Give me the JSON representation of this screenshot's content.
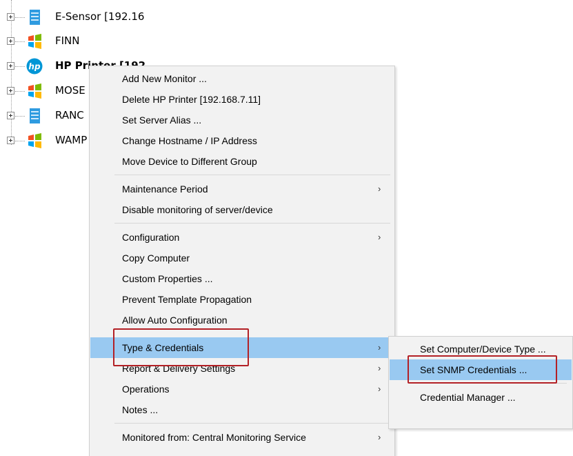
{
  "tree": {
    "items": [
      {
        "label": "E-Sensor [192.16",
        "icon": "server-icon",
        "bold": false
      },
      {
        "label": "FINN",
        "icon": "windows-icon",
        "bold": false
      },
      {
        "label": "HP Printer [192",
        "icon": "hp-logo-icon",
        "bold": true
      },
      {
        "label": "MOSE",
        "icon": "windows-icon",
        "bold": false
      },
      {
        "label": "RANC",
        "icon": "server-icon",
        "bold": false
      },
      {
        "label": "WAMP",
        "icon": "windows-icon",
        "bold": false
      }
    ]
  },
  "context_menu": {
    "items": [
      {
        "label": "Add New Monitor ...",
        "submenu": false
      },
      {
        "label": "Delete HP Printer [192.168.7.11]",
        "submenu": false
      },
      {
        "label": "Set Server Alias ...",
        "submenu": false
      },
      {
        "label": "Change Hostname / IP Address",
        "submenu": false
      },
      {
        "label": "Move Device to Different Group",
        "submenu": false
      },
      {
        "label": "Maintenance Period",
        "submenu": true
      },
      {
        "label": "Disable monitoring of server/device",
        "submenu": false
      },
      {
        "label": "Configuration",
        "submenu": true
      },
      {
        "label": "Copy Computer",
        "submenu": false
      },
      {
        "label": "Custom Properties ...",
        "submenu": false
      },
      {
        "label": "Prevent Template Propagation",
        "submenu": false
      },
      {
        "label": "Allow Auto Configuration",
        "submenu": false
      },
      {
        "label": "Type & Credentials",
        "submenu": true,
        "highlighted": true
      },
      {
        "label": "Report & Delivery Settings",
        "submenu": true
      },
      {
        "label": "Operations",
        "submenu": true
      },
      {
        "label": "Notes ...",
        "submenu": false
      },
      {
        "label": "Monitored from: Central Monitoring Service",
        "submenu": true
      }
    ],
    "arrow_glyph": "›"
  },
  "submenu": {
    "items": [
      {
        "label": "Set Computer/Device Type ..."
      },
      {
        "label": "Set SNMP Credentials ...",
        "highlighted": true
      },
      {
        "label": "Credential Manager ..."
      }
    ]
  },
  "colors": {
    "highlight": "#99c9f1",
    "annotation_red": "#b32025",
    "menu_bg": "#f2f2f2"
  }
}
